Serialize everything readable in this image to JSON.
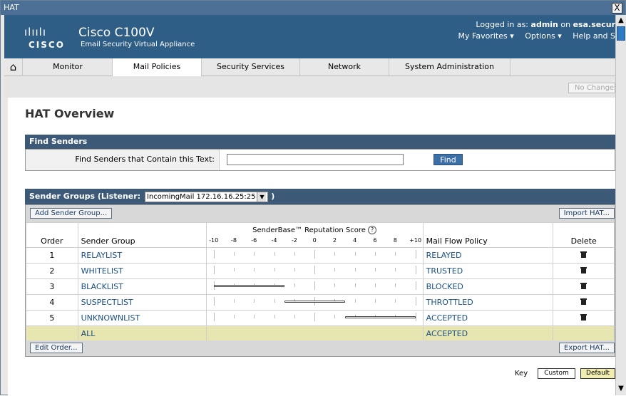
{
  "window": {
    "title": "HAT",
    "close_glyph": "X"
  },
  "header": {
    "logo_bars": "ılıılı",
    "logo_word": "CISCO",
    "product": "Cisco C100V",
    "subtitle": "Email Security Virtual Appliance",
    "login_prefix": "Logged in as:",
    "login_user": "admin",
    "login_on": "on",
    "login_host": "esa.secur",
    "favorites": "My Favorites",
    "options": "Options",
    "help": "Help and S"
  },
  "nav": {
    "home_icon": "home-icon",
    "tabs": [
      "Monitor",
      "Mail Policies",
      "Security Services",
      "Network",
      "System Administration"
    ],
    "active": "Mail Policies"
  },
  "no_changes": "No Changes",
  "page_title": "HAT Overview",
  "find": {
    "header": "Find Senders",
    "label": "Find Senders that Contain this Text:",
    "value": "",
    "button": "Find"
  },
  "sender_groups": {
    "header_prefix": "Sender Groups (Listener:",
    "listener": "IncomingMail 172.16.16.25:25",
    "header_suffix": ")",
    "add_button": "Add Sender Group...",
    "import_button": "Import HAT...",
    "edit_order_button": "Edit Order...",
    "export_button": "Export HAT...",
    "columns": {
      "order": "Order",
      "group": "Sender Group",
      "score": "SenderBase™ Reputation Score",
      "policy": "Mail Flow Policy",
      "delete": "Delete"
    },
    "score_help": "?",
    "score_axis": [
      "-10",
      "-8",
      "-6",
      "-4",
      "-2",
      "0",
      "2",
      "4",
      "6",
      "8",
      "+10"
    ],
    "rows": [
      {
        "order": "1",
        "group": "RELAYLIST",
        "policy": "RELAYED",
        "range": null
      },
      {
        "order": "2",
        "group": "WHITELIST",
        "policy": "TRUSTED",
        "range": null
      },
      {
        "order": "3",
        "group": "BLACKLIST",
        "policy": "BLOCKED",
        "range": [
          -10,
          -3
        ]
      },
      {
        "order": "4",
        "group": "SUSPECTLIST",
        "policy": "THROTTLED",
        "range": [
          -3,
          3
        ]
      },
      {
        "order": "5",
        "group": "UNKNOWNLIST",
        "policy": "ACCEPTED",
        "range": [
          3,
          10
        ]
      }
    ],
    "all_row": {
      "group": "ALL",
      "policy": "ACCEPTED"
    }
  },
  "key": {
    "label": "Key",
    "custom": "Custom",
    "default": "Default"
  }
}
